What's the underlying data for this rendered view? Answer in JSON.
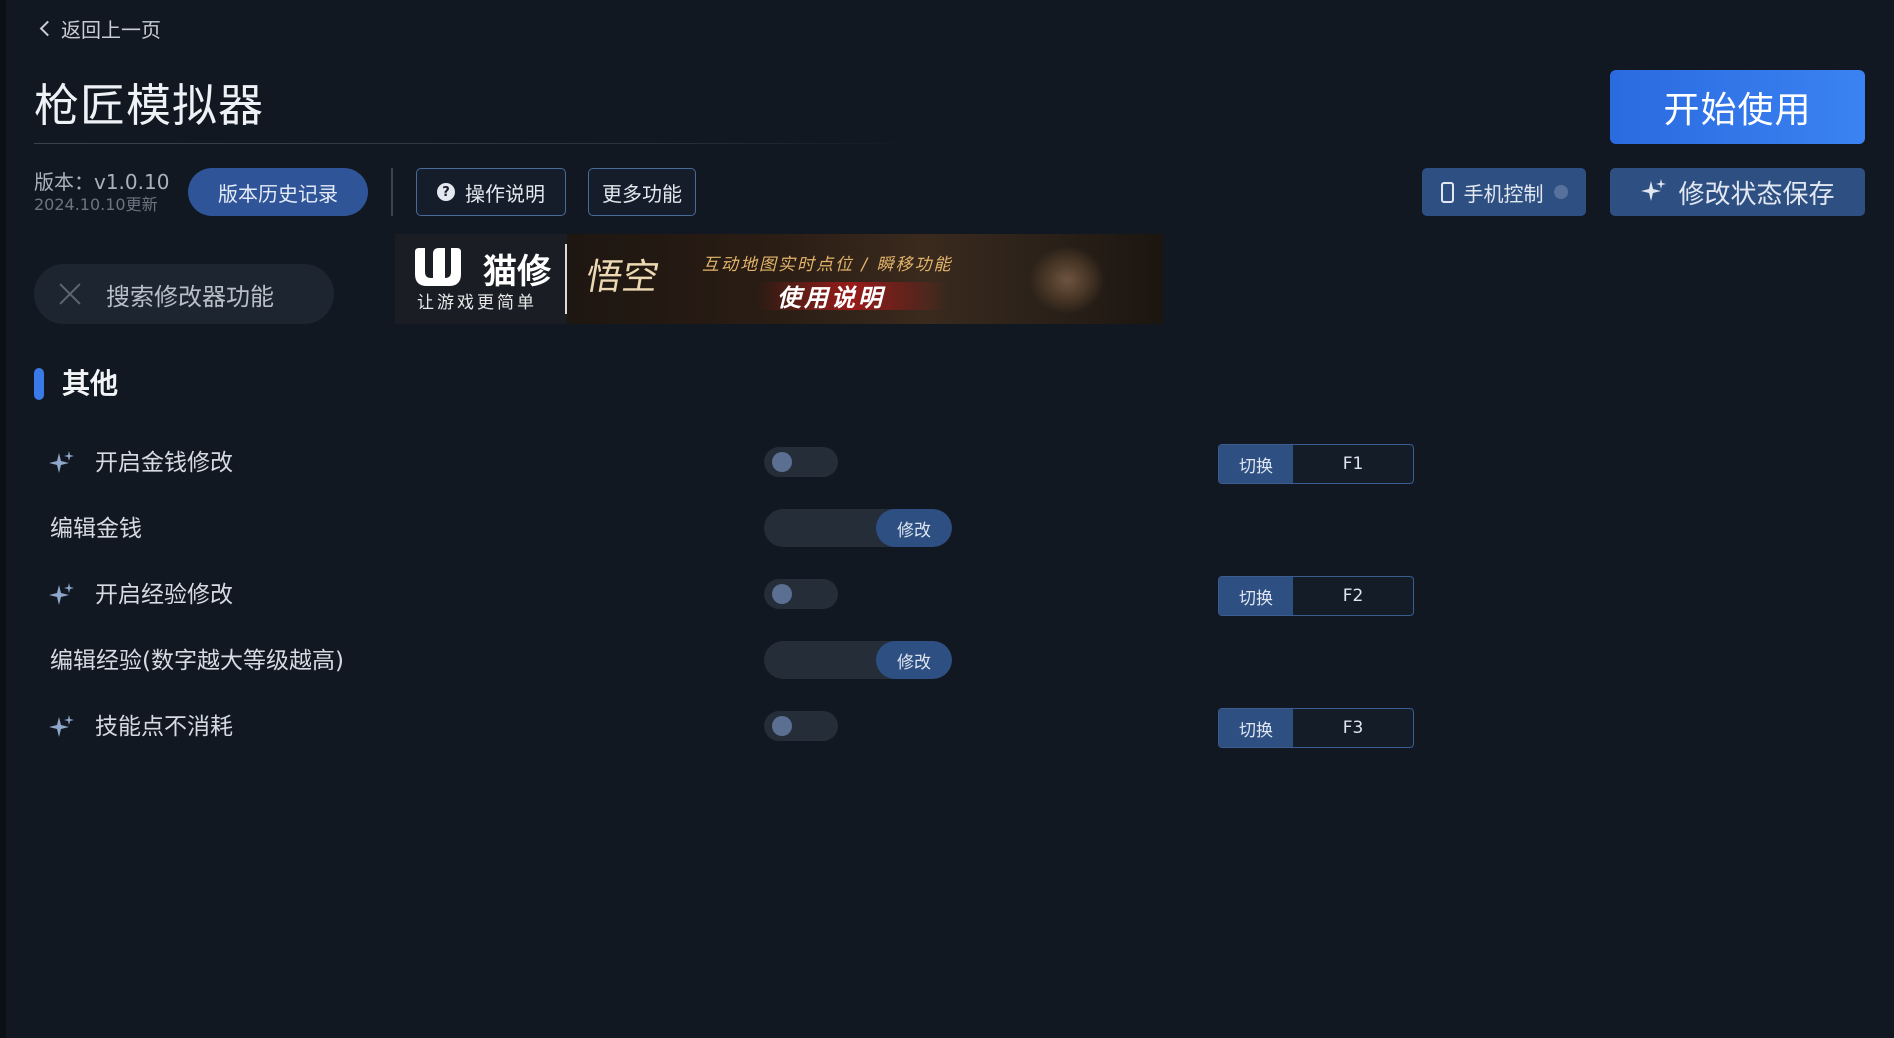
{
  "nav": {
    "back_label": "返回上一页"
  },
  "header": {
    "title": "枪匠模拟器",
    "version_label": "版本：v1.0.10",
    "version_date": "2024.10.10更新",
    "history_button": "版本历史记录",
    "guide_button": "操作说明",
    "more_button": "更多功能",
    "start_button": "开始使用",
    "phone_button": "手机控制",
    "save_button": "修改状态保存"
  },
  "search": {
    "placeholder": "搜索修改器功能"
  },
  "banner": {
    "brand": "猫修",
    "slogan": "让游戏更简单",
    "calligraphy": "悟空",
    "subtitle": "互动地图实时点位 / 瞬移功能",
    "main_text": "使用说明"
  },
  "section": {
    "title": "其他"
  },
  "rows": [
    {
      "type": "toggle",
      "label": "开启金钱修改",
      "enabled": false,
      "switch_label": "切换",
      "hotkey": "F1"
    },
    {
      "type": "edit",
      "label": "编辑金钱",
      "button": "修改"
    },
    {
      "type": "toggle",
      "label": "开启经验修改",
      "enabled": false,
      "switch_label": "切换",
      "hotkey": "F2"
    },
    {
      "type": "edit",
      "label": "编辑经验(数字越大等级越高)",
      "button": "修改"
    },
    {
      "type": "toggle",
      "label": "技能点不消耗",
      "enabled": false,
      "switch_label": "切换",
      "hotkey": "F3"
    }
  ],
  "colors": {
    "background": "#111821",
    "accent": "#3a7ae8",
    "button": "#2e4f82",
    "start_button": "#2a6be0"
  },
  "icons": [
    "back-chevron-icon",
    "help-icon",
    "phone-icon",
    "sparkle-icon",
    "close-icon",
    "logo-icon"
  ]
}
